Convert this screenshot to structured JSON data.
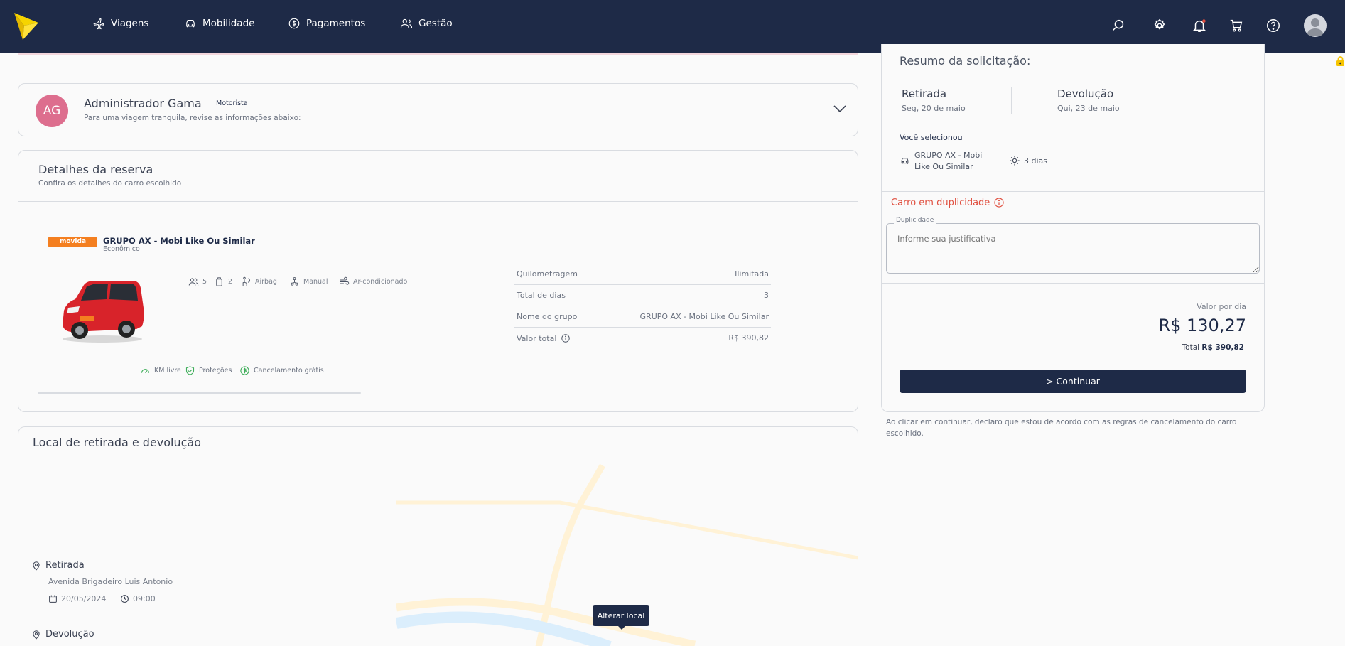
{
  "colors": {
    "navbar": "#1e2a47",
    "accent": "#1e2a47",
    "logo_yellow": "#f6d400",
    "avatar_pink": "#dd6e8e",
    "warning_red": "#e04e3e",
    "perk_green": "#3fae5a",
    "brand_orange": "#f47f20"
  },
  "nav": {
    "items": [
      {
        "label": "Viagens",
        "icon": "plane-icon"
      },
      {
        "label": "Mobilidade",
        "icon": "car-icon"
      },
      {
        "label": "Pagamentos",
        "icon": "dollar-coin-icon"
      },
      {
        "label": "Gestão",
        "icon": "users-icon"
      }
    ],
    "right_icons": [
      "search-icon",
      "gear-icon",
      "bell-icon",
      "cart-icon",
      "help-icon",
      "user-avatar-icon"
    ]
  },
  "driver": {
    "initials": "AG",
    "name": "Administrador Gama",
    "badge": "Motorista",
    "subtitle": "Para uma viagem tranquila, revise as informações abaixo:"
  },
  "reservation": {
    "title": "Detalhes da reserva",
    "subtitle": "Confira os detalhes do carro escolhido",
    "brand": "movida",
    "car_name": "GRUPO AX - Mobi Like Ou Similar",
    "category": "Econômico",
    "features": [
      {
        "icon": "passengers-icon",
        "label": "5"
      },
      {
        "icon": "luggage-icon",
        "label": "2"
      },
      {
        "icon": "airbag-icon",
        "label": "Airbag"
      },
      {
        "icon": "gearshift-icon",
        "label": "Manual"
      },
      {
        "icon": "air-conditioning-icon",
        "label": "Ar-condicionado"
      }
    ],
    "perks": [
      {
        "icon": "speedometer-icon",
        "label": "KM livre"
      },
      {
        "icon": "shield-check-icon",
        "label": "Proteções"
      },
      {
        "icon": "dollar-coin-icon",
        "label": "Cancelamento grátis"
      }
    ],
    "specs": [
      {
        "key": "Quilometragem",
        "value": "Ilimitada"
      },
      {
        "key": "Total de dias",
        "value": "3"
      },
      {
        "key": "Nome do grupo",
        "value": "GRUPO AX - Mobi Like Ou Similar"
      },
      {
        "key": "Valor total",
        "value": "R$ 390,82"
      }
    ]
  },
  "location": {
    "title": "Local de retirada e devolução",
    "pickup_label": "Retirada",
    "pickup_address": "Avenida Brigadeiro Luis Antonio",
    "pickup_date": "20/05/2024",
    "pickup_time": "09:00",
    "return_label": "Devolução",
    "map_tooltip": "Alterar local"
  },
  "summary": {
    "title": "Resumo da solicitação:",
    "pickup_label": "Retirada",
    "pickup_date": "Seg, 20 de maio",
    "return_label": "Devolução",
    "return_date": "Qui, 23 de maio",
    "selected_label": "Você selecionou",
    "selected_car_line1": "GRUPO AX - Mobi",
    "selected_car_line2": "Like Ou Similar",
    "days": "3 dias",
    "duplicate_title": "Carro em duplicidade",
    "duplicate_legend": "Duplicidade",
    "duplicate_placeholder": "Informe sua justificativa",
    "price_label": "Valor por dia",
    "price": "R$ 130,27",
    "total_label": "Total",
    "total_value": "R$ 390,82",
    "continue_label": "> Continuar",
    "disclaimer": "Ao clicar em continuar, declaro que estou de acordo com as regras de cancelamento do carro escolhido."
  }
}
